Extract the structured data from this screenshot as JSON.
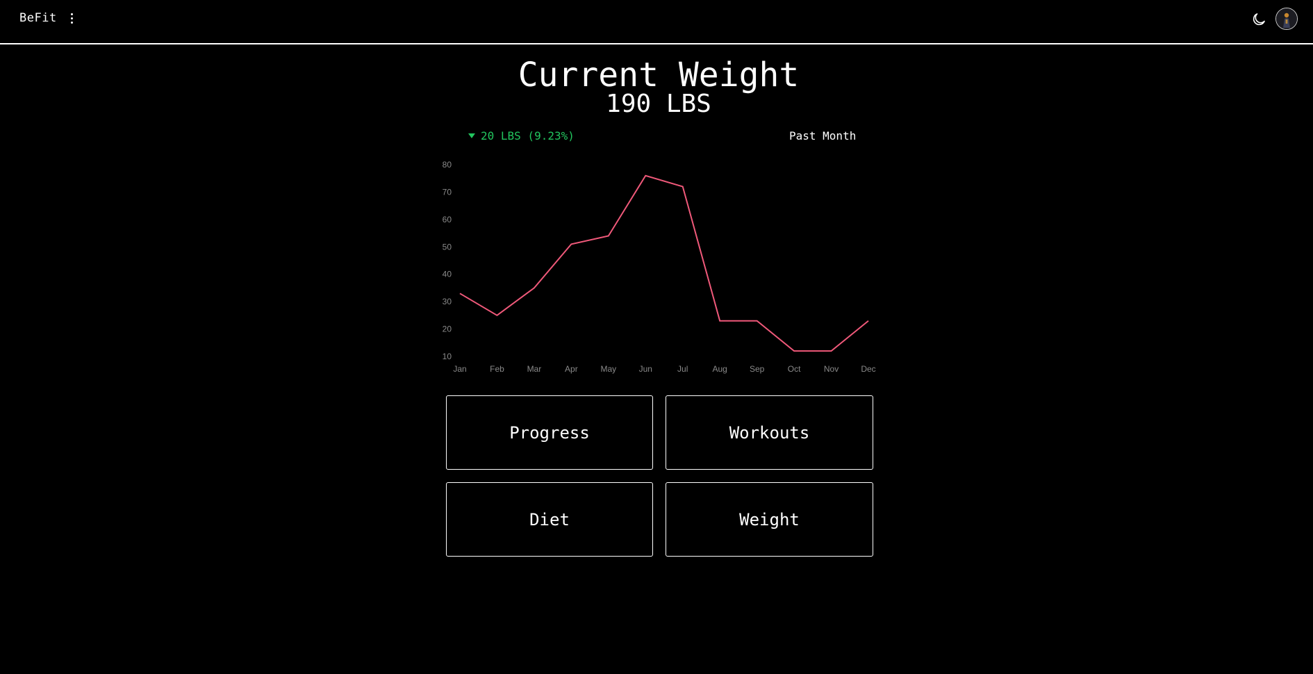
{
  "header": {
    "brand": "BeFit",
    "menu_icon": "vertical-dots-icon",
    "theme_icon": "moon-icon",
    "avatar_icon": "user-avatar"
  },
  "summary": {
    "title": "Current Weight",
    "weight": "190 LBS",
    "change": "20 LBS (9.23%)",
    "change_direction": "down",
    "change_color": "#22c55e",
    "period": "Past Month"
  },
  "tiles": {
    "progress": "Progress",
    "workouts": "Workouts",
    "diet": "Diet",
    "weight": "Weight"
  },
  "chart_data": {
    "type": "line",
    "categories": [
      "Jan",
      "Feb",
      "Mar",
      "Apr",
      "May",
      "Jun",
      "Jul",
      "Aug",
      "Sep",
      "Oct",
      "Nov",
      "Dec"
    ],
    "series": [
      {
        "values": [
          33,
          25,
          35,
          51,
          54,
          76,
          72,
          23,
          23,
          12,
          12,
          23
        ],
        "color": "#f0597a"
      }
    ],
    "y_ticks": [
      10,
      20,
      30,
      40,
      50,
      60,
      70,
      80
    ],
    "ylim": [
      10,
      80
    ],
    "grid": false,
    "legend": "none"
  }
}
